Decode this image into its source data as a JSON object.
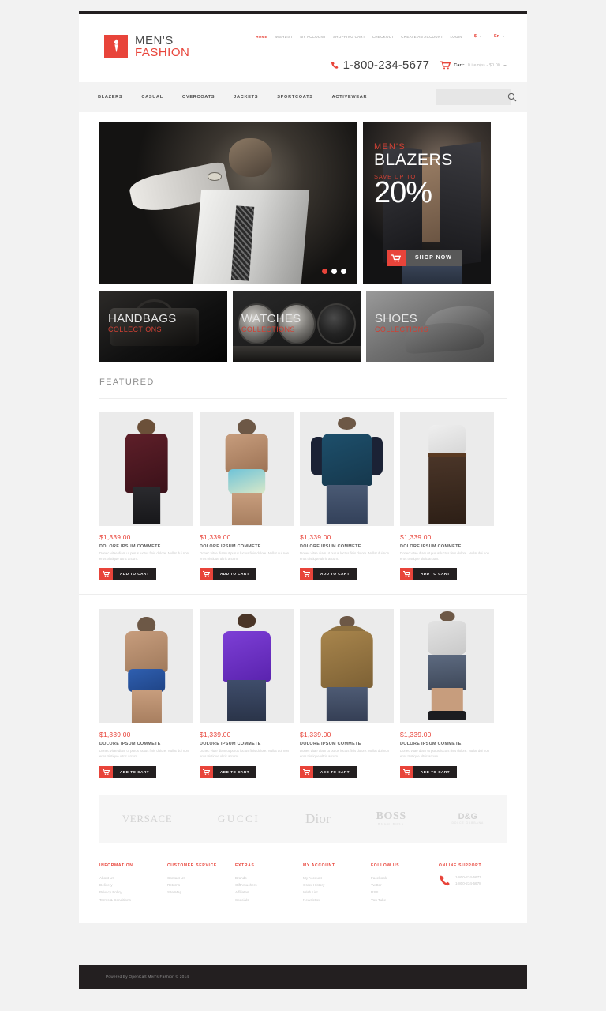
{
  "header": {
    "logo": {
      "icon": "tie-icon",
      "line1": "MEN'S",
      "line2": "FASHION"
    },
    "top_links": [
      {
        "label": "HOME",
        "active": true
      },
      {
        "label": "WISHLIST",
        "active": false
      },
      {
        "label": "MY ACCOUNT",
        "active": false
      },
      {
        "label": "SHOPPING CART",
        "active": false
      },
      {
        "label": "CHECKOUT",
        "active": false
      },
      {
        "label": "CREATE AN ACCOUNT",
        "active": false
      },
      {
        "label": "LOGIN",
        "active": false
      }
    ],
    "currency": "$",
    "language": "En",
    "phone": "1-800-234-5677",
    "cart_label": "Cart:",
    "cart_value": "0 item(s) - $0.00"
  },
  "nav": {
    "items": [
      {
        "label": "BLAZERS"
      },
      {
        "label": "CASUAL"
      },
      {
        "label": "OVERCOATS"
      },
      {
        "label": "JACKETS"
      },
      {
        "label": "SPORTCOATS"
      },
      {
        "label": "ACTIVEWEAR"
      }
    ],
    "search_placeholder": "",
    "search_value": ""
  },
  "slider": {
    "dots": [
      {
        "active": true
      },
      {
        "active": false
      },
      {
        "active": false
      }
    ]
  },
  "banner": {
    "line1": "MEN'S",
    "line2": "BLAZERS",
    "line3": "SAVE UP TO",
    "line4": "20%",
    "button": "SHOP NOW"
  },
  "tiles": [
    {
      "title": "HANDBAGS",
      "subtitle": "COLLECTIONS"
    },
    {
      "title": "WATCHES",
      "subtitle": "COLLECTIONS"
    },
    {
      "title": "SHOES",
      "subtitle": "COLLECTIONS"
    }
  ],
  "featured": {
    "heading": "FEATURED",
    "add_to_cart": "ADD TO CART",
    "products": [
      {
        "price": "$1,339.00",
        "title": "DOLORE IPSUM COMMETE",
        "desc": "Donec vitae diam ut purus luctus finis dolore. Nullat dui non eros tristique ultric arcum."
      },
      {
        "price": "$1,339.00",
        "title": "DOLORE IPSUM COMMETE",
        "desc": "Donec vitae diam ut purus luctus finis dolore. Nullat dui non eros tristique ultric arcum."
      },
      {
        "price": "$1,339.00",
        "title": "DOLORE IPSUM COMMETE",
        "desc": "Donec vitae diam ut purus luctus finis dolore. Nullat dui non eros tristique ultric arcum."
      },
      {
        "price": "$1,339.00",
        "title": "DOLORE IPSUM COMMETE",
        "desc": "Donec vitae diam ut purus luctus finis dolore. Nullat dui non eros tristique ultric arcum."
      },
      {
        "price": "$1,339.00",
        "title": "DOLORE IPSUM COMMETE",
        "desc": "Donec vitae diam ut purus luctus finis dolore. Nullat dui non eros tristique ultric arcum."
      },
      {
        "price": "$1,339.00",
        "title": "DOLORE IPSUM COMMETE",
        "desc": "Donec vitae diam ut purus luctus finis dolore. Nullat dui non eros tristique ultric arcum."
      },
      {
        "price": "$1,339.00",
        "title": "DOLORE IPSUM COMMETE",
        "desc": "Donec vitae diam ut purus luctus finis dolore. Nullat dui non eros tristique ultric arcum."
      },
      {
        "price": "$1,339.00",
        "title": "DOLORE IPSUM COMMETE",
        "desc": "Donec vitae diam ut purus luctus finis dolore. Nullat dui non eros tristique ultric arcum."
      }
    ]
  },
  "brands": [
    {
      "name": "VERSACE",
      "sub": ""
    },
    {
      "name": "GUCCI",
      "sub": ""
    },
    {
      "name": "Dior",
      "sub": ""
    },
    {
      "name": "BOSS",
      "sub": "HUGO BOSS"
    },
    {
      "name": "D&G",
      "sub": "DOLCE  GABBANA"
    }
  ],
  "footer": {
    "columns": [
      {
        "title": "INFORMATION",
        "links": [
          "About Us",
          "Delivery",
          "Privacy Policy",
          "Terms & Conditions"
        ]
      },
      {
        "title": "CUSTOMER SERVICE",
        "links": [
          "Contact Us",
          "Returns",
          "Site Map"
        ]
      },
      {
        "title": "EXTRAS",
        "links": [
          "Brands",
          "Gift Vouchers",
          "Affiliates",
          "Specials"
        ]
      },
      {
        "title": "MY ACCOUNT",
        "links": [
          "My Account",
          "Order History",
          "Wish List",
          "Newsletter"
        ]
      },
      {
        "title": "FOLLOW US",
        "links": [
          "Facebook",
          "Twitter",
          "RSS",
          "You Tube"
        ]
      }
    ],
    "support": {
      "title": "ONLINE SUPPORT",
      "phones": [
        "1-800-234-5677",
        "1-800-234-5678"
      ]
    },
    "copyright": "Powered By OpenCart Men's Fashion © 2014"
  },
  "colors": {
    "accent": "#e8443a",
    "dark": "#231f20",
    "muted": "#c6c6c6"
  }
}
